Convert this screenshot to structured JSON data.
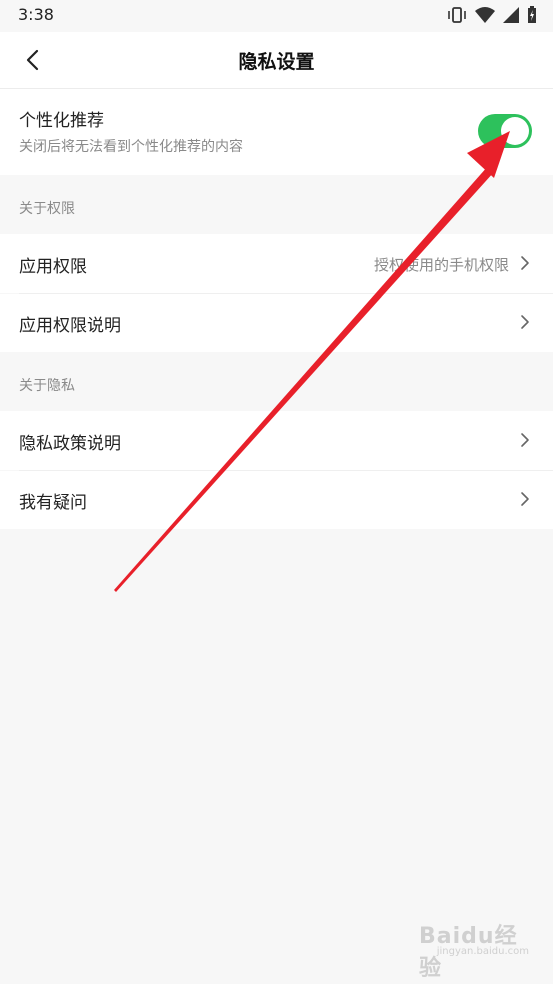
{
  "status_bar": {
    "time": "3:38",
    "icons": [
      "vibrate-icon",
      "wifi-icon",
      "signal-icon",
      "battery-charging-icon"
    ]
  },
  "header": {
    "title": "隐私设置",
    "back_icon": "chevron-left-icon"
  },
  "personalized": {
    "label": "个性化推荐",
    "description": "关闭后将无法看到个性化推荐的内容",
    "enabled": true,
    "toggle_color": "#2dc15c"
  },
  "permissions_section": {
    "header": "关于权限",
    "items": [
      {
        "label": "应用权限",
        "value": "授权使用的手机权限"
      },
      {
        "label": "应用权限说明",
        "value": ""
      }
    ]
  },
  "privacy_section": {
    "header": "关于隐私",
    "items": [
      {
        "label": "隐私政策说明"
      },
      {
        "label": "我有疑问"
      }
    ]
  },
  "annotation": {
    "arrow_color": "#e8202a"
  },
  "watermark": {
    "main": "Baidu经验",
    "sub": "jingyan.baidu.com"
  }
}
